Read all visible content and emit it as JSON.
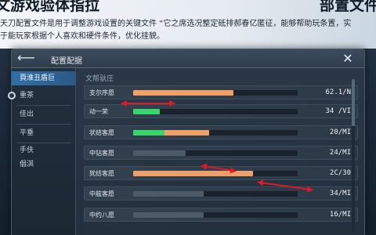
{
  "header": {
    "left_title": "文游戏验体指拉",
    "right_title": "部置文件",
    "line1": "天刀配置文件是用于调整游戏设置的关键文件 “它之席选况整定砥排郝春亿匿征，能够帮助玩条置，实",
    "line2": "于能玩家根据个人喜欢和硬件条件，优化挂貌。"
  },
  "window": {
    "title": "配置配据",
    "back_icon": "left-arrow-icon",
    "close_icon": "close-icon"
  },
  "sidebar": {
    "items": [
      {
        "label": "頁淮丑盾巨",
        "active": true
      },
      {
        "label": "重茶",
        "active": false
      },
      {
        "label": "佳出",
        "active": false
      },
      {
        "label": "平垂",
        "active": false
      },
      {
        "label": "手伕",
        "active": false
      },
      {
        "label": "倡淇",
        "active": false
      }
    ]
  },
  "main": {
    "section_title": "文帮驮庄",
    "rows": [
      {
        "label": "支尔序愿",
        "value": "62.1/N",
        "fill": 0.61,
        "color": "#f0a066"
      },
      {
        "label": "动一荣",
        "value": "34 /VI",
        "fill": 0.16,
        "color": "#37d66a"
      },
      {
        "label": "状结客愿",
        "value": "20/MI",
        "fill": 0.46,
        "color": "#f0a066",
        "green_part": 0.19
      },
      {
        "label": "中钻客愿",
        "value": "24/MI",
        "fill": 0.32,
        "color": "#4d5b69"
      },
      {
        "label": "犹纺客愿",
        "value": "2C/30",
        "fill": 0.73,
        "color": "#f0a066"
      },
      {
        "label": "中舷客愿",
        "value": "34/MI",
        "fill": 0.43,
        "color": "#4d5b69"
      },
      {
        "label": "中约八愿",
        "value": "16/MI",
        "fill": 0.43,
        "color": "#4d5b69"
      }
    ]
  },
  "annotations": {
    "arrow_color": "#e0182a"
  }
}
